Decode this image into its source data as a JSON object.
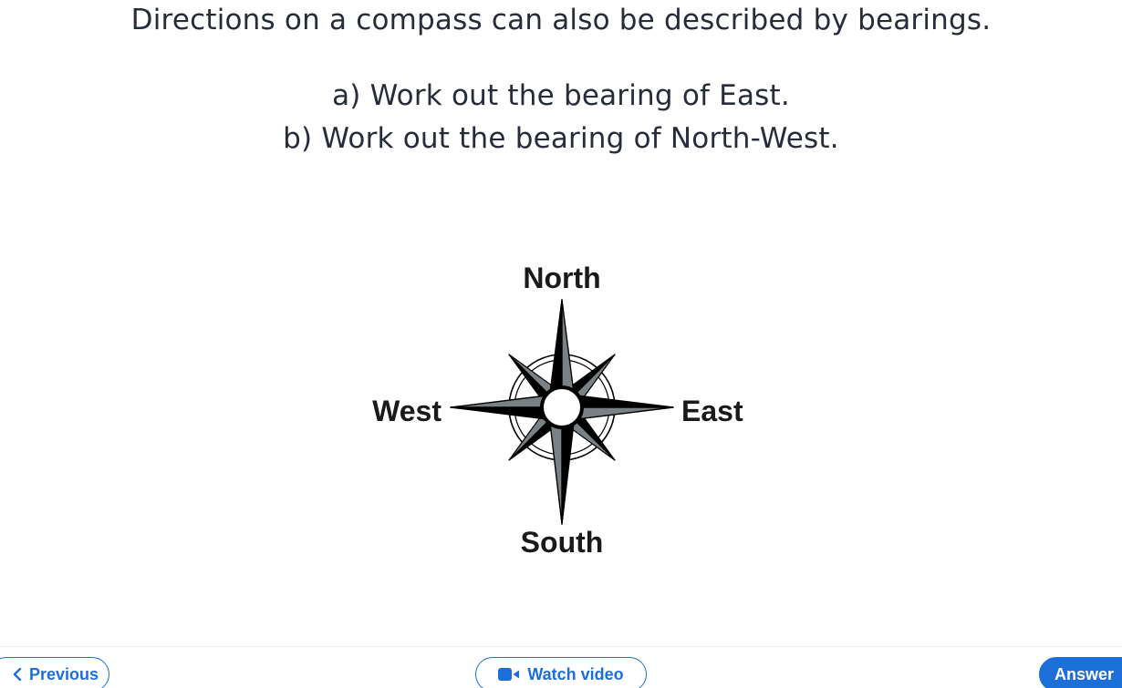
{
  "question": {
    "intro": "Directions on a compass can also be described by bearings.",
    "part_a": "a) Work out the bearing of East.",
    "part_b": "b) Work out the bearing of North-West."
  },
  "compass": {
    "north_label": "North",
    "south_label": "South",
    "east_label": "East",
    "west_label": "West",
    "colors": {
      "dark_fill": "#000000",
      "light_fill": "#7a8185",
      "outline": "#000000"
    }
  },
  "footer": {
    "previous_label": "Previous",
    "watch_video_label": "Watch video",
    "answer_label": "Answer",
    "icons": {
      "previous": "chevron-left-icon",
      "watch_video": "video-camera-icon"
    },
    "colors": {
      "accent": "#1c6fd8"
    }
  }
}
